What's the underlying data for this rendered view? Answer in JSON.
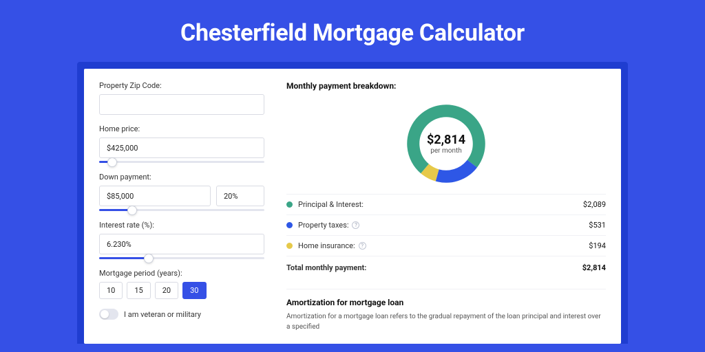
{
  "title": "Chesterfield Mortgage Calculator",
  "form": {
    "zip_label": "Property Zip Code:",
    "zip_value": "",
    "home_price_label": "Home price:",
    "home_price_value": "$425,000",
    "home_price_slider_pct": 8,
    "down_payment_label": "Down payment:",
    "down_payment_value": "$85,000",
    "down_payment_pct_value": "20%",
    "down_payment_slider_pct": 20,
    "rate_label": "Interest rate (%):",
    "rate_value": "6.230%",
    "rate_slider_pct": 30,
    "period_label": "Mortgage period (years):",
    "periods": [
      "10",
      "15",
      "20",
      "30"
    ],
    "period_active_index": 3,
    "veteran_label": "I am veteran or military",
    "veteran_on": false
  },
  "breakdown": {
    "title": "Monthly payment breakdown:",
    "center_amount": "$2,814",
    "center_sub": "per month",
    "items": [
      {
        "color": "green",
        "label": "Principal & Interest:",
        "value": "$2,089",
        "info": false
      },
      {
        "color": "blue",
        "label": "Property taxes:",
        "value": "$531",
        "info": true
      },
      {
        "color": "yellow",
        "label": "Home insurance:",
        "value": "$194",
        "info": true
      }
    ],
    "total_label": "Total monthly payment:",
    "total_value": "$2,814"
  },
  "chart_data": {
    "type": "pie",
    "title": "Monthly payment breakdown",
    "series": [
      {
        "name": "Principal & Interest",
        "value": 2089,
        "color": "#3aa587"
      },
      {
        "name": "Property taxes",
        "value": 531,
        "color": "#2e57e6"
      },
      {
        "name": "Home insurance",
        "value": 194,
        "color": "#e6c94a"
      }
    ],
    "total": 2814
  },
  "amortization": {
    "title": "Amortization for mortgage loan",
    "text": "Amortization for a mortgage loan refers to the gradual repayment of the loan principal and interest over a specified"
  }
}
